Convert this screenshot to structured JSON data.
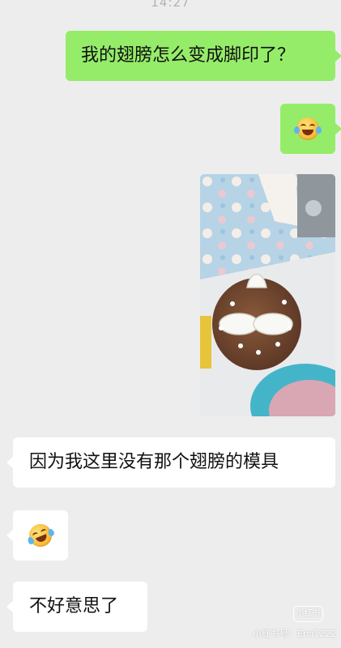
{
  "status": {
    "time": "14:27"
  },
  "messages": [
    {
      "side": "right",
      "type": "text",
      "text": "我的翅膀怎么变成脚印了？"
    },
    {
      "side": "right",
      "type": "emoji",
      "emoji": "laughing-with-tears-icon"
    },
    {
      "side": "right",
      "type": "image",
      "image": "photo of a chocolate cake decorated with white frosting footprints"
    },
    {
      "side": "left",
      "type": "text",
      "text": "因为我这里没有那个翅膀的模具"
    },
    {
      "side": "left",
      "type": "emoji",
      "emoji": "rolling-laughing-icon"
    },
    {
      "side": "left",
      "type": "text",
      "text": "不好意思了"
    }
  ],
  "watermark": {
    "badge": "小红书",
    "text": "小红书号：Erci1222"
  },
  "colors": {
    "background": "#ededed",
    "sent_bubble": "#95ec69",
    "received_bubble": "#ffffff"
  }
}
